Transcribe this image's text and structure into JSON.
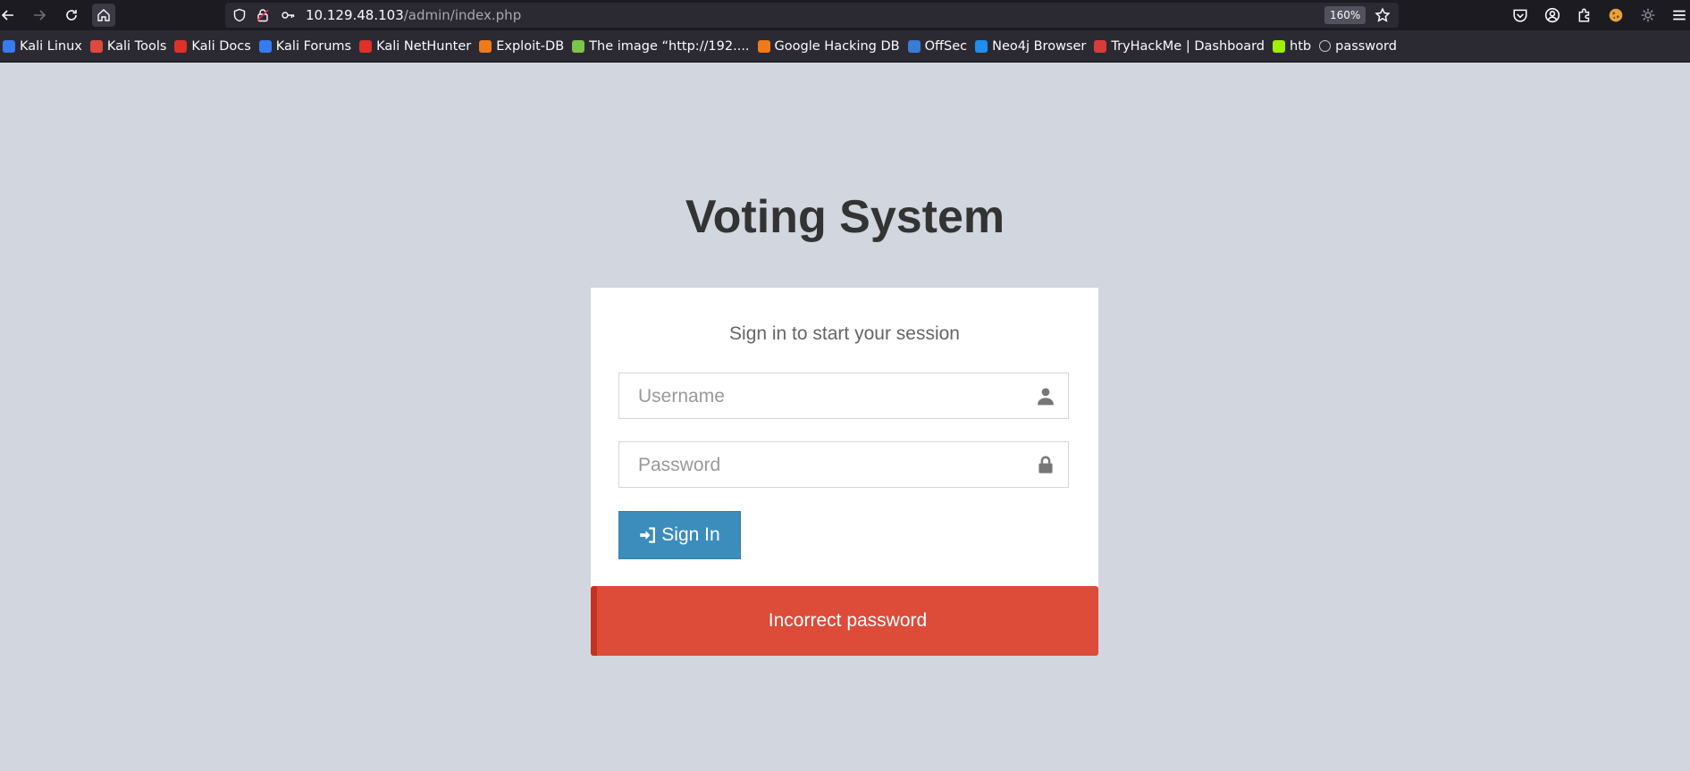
{
  "browser": {
    "url_host": "10.129.48.103",
    "url_path": "/admin/index.php",
    "zoom": "160%",
    "bookmarks": [
      {
        "label": "Kali Linux",
        "color": "#367bf0"
      },
      {
        "label": "Kali Tools",
        "color": "#e0493d"
      },
      {
        "label": "Kali Docs",
        "color": "#e0302a"
      },
      {
        "label": "Kali Forums",
        "color": "#367bf0"
      },
      {
        "label": "Kali NetHunter",
        "color": "#e0302a"
      },
      {
        "label": "Exploit-DB",
        "color": "#f07a1a"
      },
      {
        "label": "The image “http://192....",
        "color": "#7ec34a"
      },
      {
        "label": "Google Hacking DB",
        "color": "#f07a1a"
      },
      {
        "label": "OffSec",
        "color": "#3a7bd5"
      },
      {
        "label": "Neo4j Browser",
        "color": "#1f8ef1"
      },
      {
        "label": "TryHackMe | Dashboard",
        "color": "#d93b3b"
      },
      {
        "label": "htb",
        "color": "#9fef00"
      },
      {
        "label": "password",
        "color": "#cccccc"
      }
    ]
  },
  "page": {
    "title": "Voting System",
    "login_box_msg": "Sign in to start your session",
    "username_placeholder": "Username",
    "password_placeholder": "Password",
    "signin_label": "Sign In",
    "error_message": "Incorrect password"
  }
}
